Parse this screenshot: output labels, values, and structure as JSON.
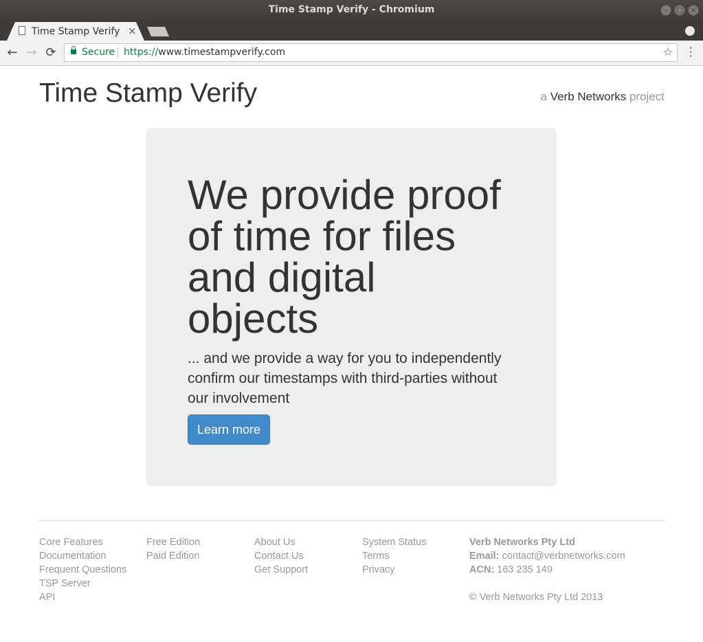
{
  "window": {
    "title": "Time Stamp Verify - Chromium"
  },
  "tabs": [
    {
      "title": "Time Stamp Verify",
      "close": "×"
    }
  ],
  "toolbar": {
    "back": "←",
    "forward": "→",
    "reload": "⟳",
    "security_label": "Secure",
    "url_scheme": "https://",
    "url_rest": "www.timestampverify.com",
    "bookmark": "☆",
    "menu": "⋮"
  },
  "header": {
    "site_title": "Time Stamp Verify",
    "tagline_prefix": "a",
    "tagline_brand": "Verb Networks",
    "tagline_suffix": "project"
  },
  "hero": {
    "headline": "We provide proof of time for files and digital objects",
    "lead": "... and we provide a way for you to independently confirm our timestamps with third-parties without our involvement",
    "button_label": "Learn more"
  },
  "footer": {
    "col1": [
      "Core Features",
      "Documentation",
      "Frequent Questions",
      "TSP Server",
      "API"
    ],
    "col2": [
      "Free Edition",
      "Paid Edition"
    ],
    "col3": [
      "About Us",
      "Contact Us",
      "Get Support"
    ],
    "col4": [
      "System Status",
      "Terms",
      "Privacy"
    ],
    "company": {
      "name": "Verb Networks Pty Ltd",
      "email_label": "Email:",
      "email": "contact@verbnetworks.com",
      "acn_label": "ACN:",
      "acn": "163 235 149",
      "copyright": "© Verb Networks Pty Ltd 2013"
    }
  }
}
